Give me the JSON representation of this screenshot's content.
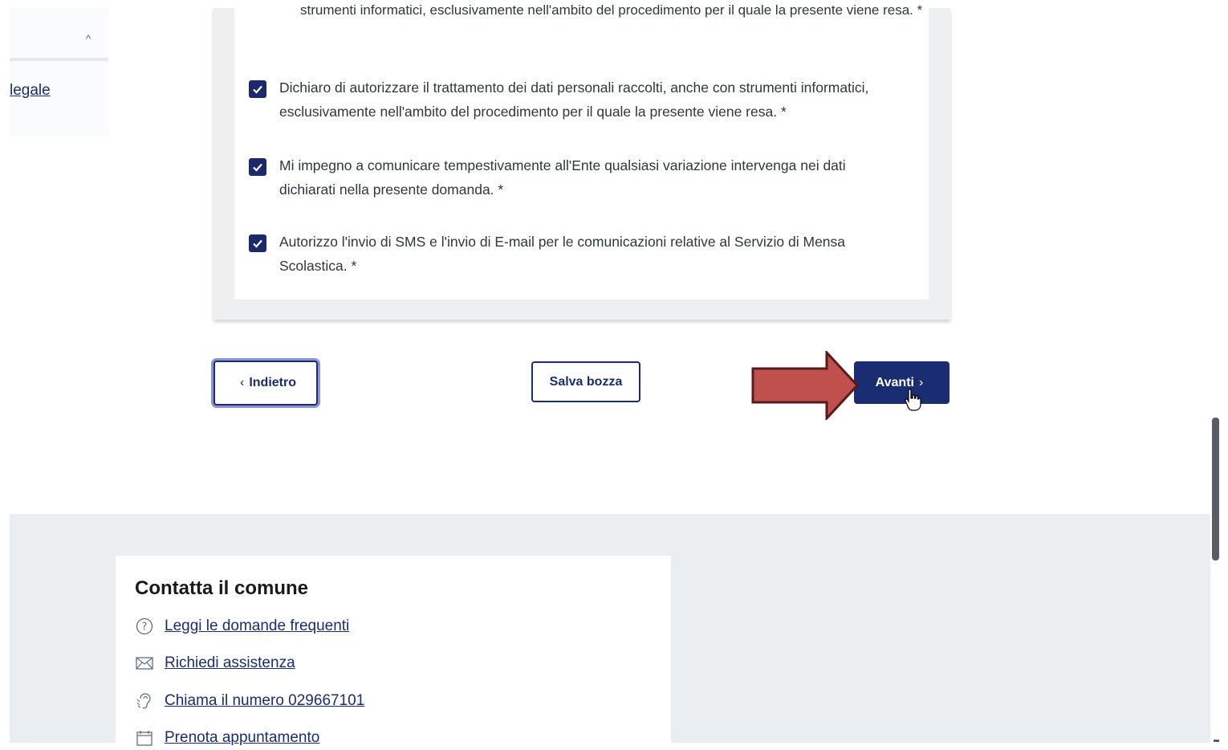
{
  "sidebar": {
    "caret": "^",
    "link_label": "legale"
  },
  "consents": {
    "partial_top": "strumenti informatici, esclusivamente nell'ambito del procedimento per il quale la presente viene resa. *",
    "items": [
      {
        "label": "Dichiaro di autorizzare il trattamento dei dati personali raccolti, anche con strumenti informatici, esclusivamente nell'ambito del procedimento per il quale la presente viene resa. *",
        "checked": true
      },
      {
        "label": "Mi impegno a comunicare tempestivamente all'Ente qualsiasi variazione intervenga nei dati dichiarati nella presente domanda. *",
        "checked": true
      },
      {
        "label": "Autorizzo l'invio di SMS e l'invio di E-mail per le comunicazioni relative al Servizio di Mensa Scolastica. *",
        "checked": true
      }
    ]
  },
  "nav": {
    "back_label": "Indietro",
    "back_icon": "chevron-left-icon",
    "draft_label": "Salva bozza",
    "next_label": "Avanti",
    "next_icon": "chevron-right-icon"
  },
  "contact": {
    "title": "Contatta il comune",
    "items": [
      {
        "icon": "question-circle-icon",
        "label": "Leggi le domande frequenti"
      },
      {
        "icon": "mail-icon",
        "label": "Richiedi assistenza"
      },
      {
        "icon": "hearing-icon",
        "label": "Chiama il numero 029667101"
      },
      {
        "icon": "calendar-icon",
        "label": "Prenota appuntamento"
      }
    ]
  },
  "colors": {
    "primary": "#1a2d72",
    "annotation_arrow": "#c0504d",
    "footer_bg": "#ebeef0"
  }
}
